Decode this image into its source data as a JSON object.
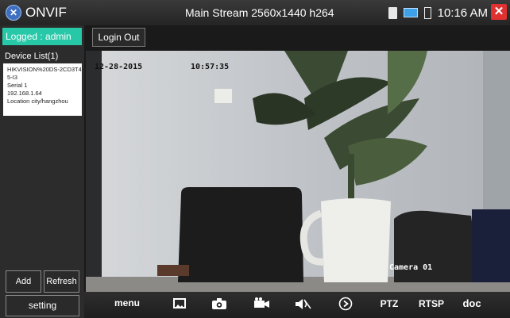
{
  "topbar": {
    "app_title": "ONVIF",
    "stream_title": "Main Stream 2560x1440 h264",
    "time": "10:16 AM"
  },
  "sidebar": {
    "logged_label": "Logged : admin",
    "device_list_title": "Device List(1)",
    "device": {
      "name": "HIKVISION%20DS-2CD3T45-I3",
      "serial": "Serial 1",
      "ip": "192.168.1.64",
      "location": "Location city/hangzhou"
    },
    "add_label": "Add",
    "refresh_label": "Refresh",
    "setting_label": "setting"
  },
  "login_out_label": "Login Out",
  "video": {
    "osd_date": "12-28-2015",
    "osd_time": "10:57:35",
    "camera_label": "Camera 01"
  },
  "toolbar": {
    "menu_label": "menu",
    "ptz_label": "PTZ",
    "rtsp_label": "RTSP",
    "doc_label": "doc"
  },
  "icons": [
    "onvif-logo",
    "sd-card",
    "network",
    "battery",
    "close",
    "image",
    "camera",
    "video-record",
    "mute",
    "play"
  ],
  "colors": {
    "accent": "#26c8a8",
    "close": "#e03030",
    "bar": "#2c2c2c"
  }
}
